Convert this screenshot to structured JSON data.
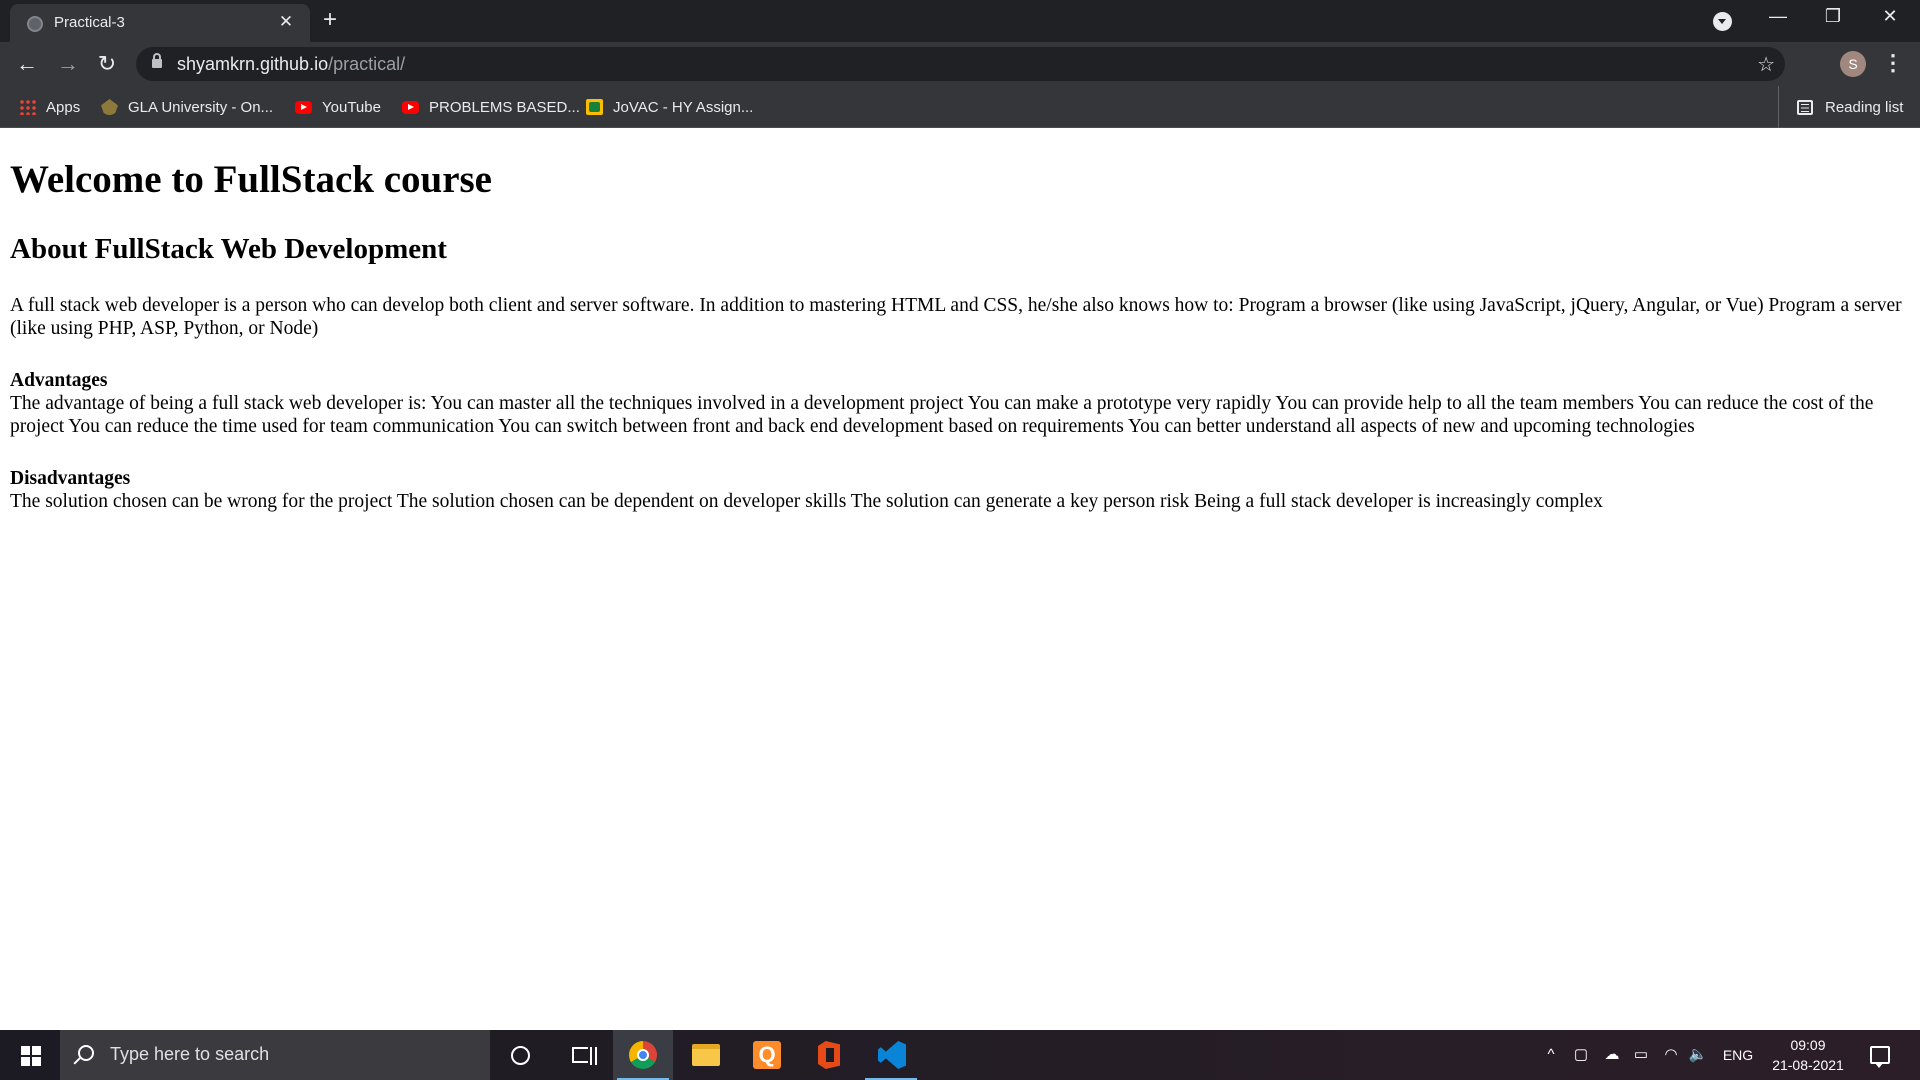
{
  "browser": {
    "tab_title": "Practical-3",
    "tab_close": "✕",
    "new_tab": "+",
    "url_host": "shyamkrn.github.io",
    "url_path": "/practical/",
    "profile_initial": "S",
    "window_controls": {
      "minimize": "—",
      "restore": "❐",
      "close": "✕"
    },
    "bookmarks": [
      {
        "label": "Apps",
        "icon": "apps-grid-icon"
      },
      {
        "label": "GLA University - On...",
        "icon": "gla-logo-icon"
      },
      {
        "label": "YouTube",
        "icon": "youtube-icon"
      },
      {
        "label": "PROBLEMS BASED...",
        "icon": "youtube-icon"
      },
      {
        "label": "JoVAC - HY Assign...",
        "icon": "google-classroom-icon"
      }
    ],
    "reading_list": "Reading list"
  },
  "page": {
    "h1": "Welcome to FullStack course",
    "h2": "About FullStack Web Development",
    "intro": "A full stack web developer is a person who can develop both client and server software. In addition to mastering HTML and CSS, he/she also knows how to: Program a browser (like using JavaScript, jQuery, Angular, or Vue) Program a server (like using PHP, ASP, Python, or Node)",
    "advantages_title": "Advantages",
    "advantages_text": "The advantage of being a full stack web developer is: You can master all the techniques involved in a development project You can make a prototype very rapidly You can provide help to all the team members You can reduce the cost of the project You can reduce the time used for team communication You can switch between front and back end development based on requirements You can better understand all aspects of new and upcoming technologies",
    "disadvantages_title": "Disadvantages",
    "disadvantages_text": "The solution chosen can be wrong for the project The solution chosen can be dependent on developer skills The solution can generate a key person risk Being a full stack developer is increasingly complex"
  },
  "taskbar": {
    "search_placeholder": "Type here to search",
    "language": "ENG",
    "time": "09:09",
    "date": "21-08-2021"
  },
  "colors": {
    "chrome_dark": "#202124",
    "chrome_toolbar": "#35363a",
    "taskbar": "#1c1a22",
    "taskbar_search": "#3b3a3e"
  }
}
